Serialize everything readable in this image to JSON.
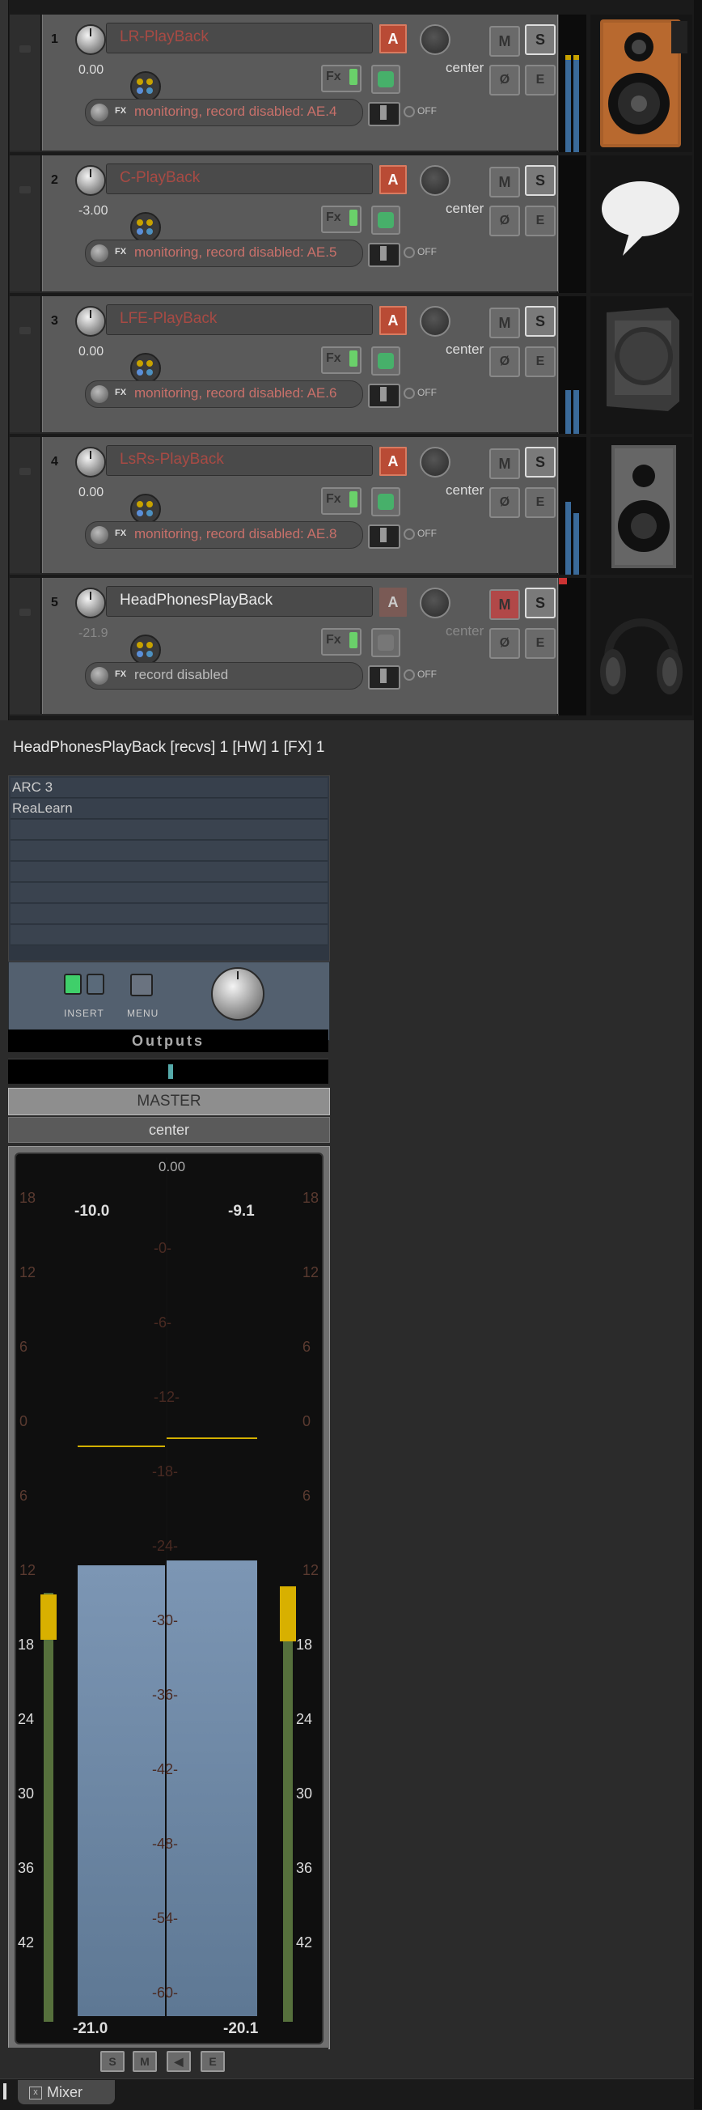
{
  "tracks": [
    {
      "num": "1",
      "name": "LR-PlayBack",
      "name_style": "red",
      "volume": "0.00",
      "pan": "center",
      "input": "monitoring, record disabled: AE.4",
      "input_style": "red",
      "off": "OFF",
      "fx": "Fx",
      "fx_label": "FX",
      "a": "A",
      "m": "M",
      "s": "S",
      "e": "E",
      "phase": "Ø",
      "art": "wooden-speaker"
    },
    {
      "num": "2",
      "name": "C-PlayBack",
      "name_style": "red",
      "volume": "-3.00",
      "pan": "center",
      "input": "monitoring, record disabled: AE.5",
      "input_style": "red",
      "off": "OFF",
      "fx": "Fx",
      "fx_label": "FX",
      "a": "A",
      "m": "M",
      "s": "S",
      "e": "E",
      "phase": "Ø",
      "art": "speech-bubble"
    },
    {
      "num": "3",
      "name": "LFE-PlayBack",
      "name_style": "red",
      "volume": "0.00",
      "pan": "center",
      "input": "monitoring, record disabled: AE.6",
      "input_style": "red",
      "off": "OFF",
      "fx": "Fx",
      "fx_label": "FX",
      "a": "A",
      "m": "M",
      "s": "S",
      "e": "E",
      "phase": "Ø",
      "art": "subwoofer"
    },
    {
      "num": "4",
      "name": "LsRs-PlayBack",
      "name_style": "red",
      "volume": "0.00",
      "pan": "center",
      "input": "monitoring, record disabled: AE.8",
      "input_style": "red",
      "off": "OFF",
      "fx": "Fx",
      "fx_label": "FX",
      "a": "A",
      "m": "M",
      "s": "S",
      "e": "E",
      "phase": "Ø",
      "art": "grey-speaker"
    },
    {
      "num": "5",
      "name": "HeadPhonesPlayBack",
      "name_style": "white",
      "volume": "-21.9",
      "pan": "center",
      "input": "record disabled",
      "input_style": "grey",
      "off": "OFF",
      "fx": "Fx",
      "fx_label": "FX",
      "a": "A",
      "m": "M",
      "s": "S",
      "e": "E",
      "phase": "Ø",
      "art": "headphones"
    }
  ],
  "fx_window_title": "HeadPhonesPlayBack [recvs] 1 [HW] 1 [FX] 1",
  "fx_list": [
    "ARC 3",
    "ReaLearn"
  ],
  "insert_label": "INSERT",
  "menu_label": "MENU",
  "outputs_label": "Outputs",
  "master": {
    "label": "MASTER",
    "pan": "center",
    "volume": "0.00",
    "peak_left": "-10.0",
    "peak_right": "-9.1",
    "rms_left": "-21.0",
    "rms_right": "-20.1",
    "scale_side": [
      "18",
      "12",
      "6",
      "0",
      "6",
      "12",
      "18",
      "24",
      "30",
      "36",
      "42"
    ],
    "scale_center": [
      "-0-",
      "-6-",
      "-12-",
      "-18-",
      "-24-",
      "-30-",
      "-36-",
      "-42-",
      "-48-",
      "-54-",
      "-60-"
    ],
    "bottom_buttons": [
      "S",
      "M",
      "◀",
      "E"
    ]
  },
  "tab": {
    "label": "Mixer",
    "close_glyph": "x"
  },
  "colors": {
    "accent_red": "#b94b35",
    "fx_green": "#6ad06a",
    "meter_blue": "#6f8aa8",
    "peak_yellow": "#d8b000"
  }
}
